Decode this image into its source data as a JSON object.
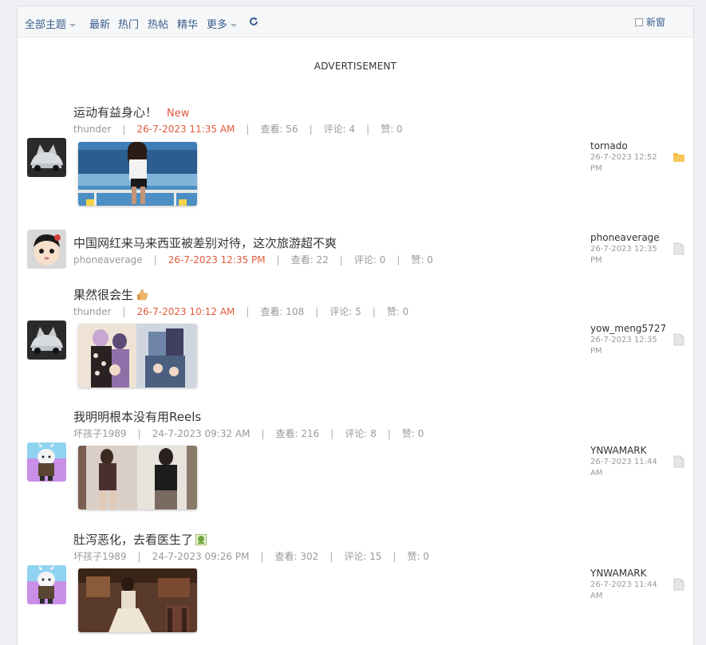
{
  "toolbar": {
    "all_topics": "全部主题",
    "latest": "最新",
    "hot": "热门",
    "hot_posts": "热帖",
    "featured": "精华",
    "more": "更多",
    "new_window": "新窗"
  },
  "ad_label": "ADVERTISEMENT",
  "threads": [
    {
      "title": "运动有益身心！",
      "new_badge": "New",
      "author": "thunder",
      "time": "26-7-2023 11:35 AM",
      "views": "查看: 56",
      "replies": "评论: 4",
      "likes": "赞: 0",
      "last_user": "tornado",
      "last_time": "26-7-2023 12:52 PM"
    },
    {
      "title": "中国网红来马来西亚被差别对待，这次旅游超不爽",
      "author": "phoneaverage",
      "time": "26-7-2023 12:35 PM",
      "views": "查看: 22",
      "replies": "评论: 0",
      "likes": "赞: 0",
      "last_user": "phoneaverage",
      "last_time": "26-7-2023 12:35 PM"
    },
    {
      "title": "果然很会生",
      "author": "thunder",
      "time": "26-7-2023 10:12 AM",
      "views": "查看: 108",
      "replies": "评论: 5",
      "likes": "赞: 0",
      "last_user": "yow_meng5727",
      "last_time": "26-7-2023 12:35 PM"
    },
    {
      "title": "我明明根本没有用Reels",
      "author": "坏孩子1989",
      "time": "24-7-2023 09:32 AM",
      "views": "查看: 216",
      "replies": "评论: 8",
      "likes": "赞: 0",
      "last_user": "YNWAMARK",
      "last_time": "26-7-2023 11:44 AM"
    },
    {
      "title": "肚泻恶化，去看医生了",
      "author": "坏孩子1989",
      "time": "24-7-2023 09:26 PM",
      "views": "查看: 302",
      "replies": "评论: 15",
      "likes": "赞: 0",
      "last_user": "YNWAMARK",
      "last_time": "26-7-2023 11:44 AM"
    }
  ],
  "colors": {
    "link": "#3a5f8a",
    "accent_red": "#e2593d",
    "folder_new": "#f5b93a",
    "folder_old": "#d8d8d8"
  },
  "icons": {
    "refresh": "refresh-icon",
    "folder": "folder-icon",
    "thumbs_up": "thumbs-up-emoji-icon",
    "sick": "sick-emoji-icon"
  }
}
